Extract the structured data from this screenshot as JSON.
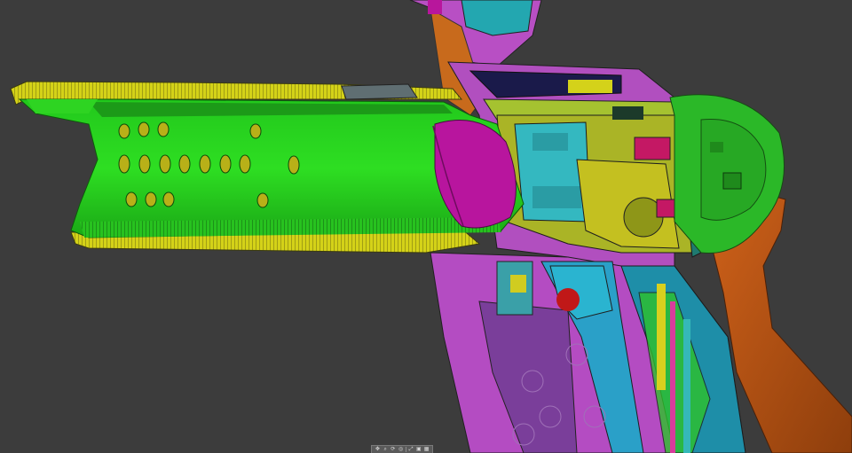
{
  "viewport": {
    "background": "#3c3c3c",
    "model_part_colors": {
      "barrel": "#22d41e",
      "barrel_shade": "#17a813",
      "shroud": "#d8d619",
      "bolt": "#b8159e",
      "frame": "#a84fb8",
      "receiver": "#2bb2b8",
      "hammer": "#e0e020",
      "grip": "#c65a14",
      "grip_panel": "#7a3e9a",
      "end_cap": "#2ac22a",
      "trigger_guard": "#2a9cc4",
      "trigger_part": "#c01818"
    }
  },
  "nav_bar": {
    "buttons": [
      {
        "icon": "pan-icon",
        "glyph": "✥"
      },
      {
        "icon": "zoom-icon",
        "glyph": "⌕"
      },
      {
        "icon": "orbit-icon",
        "glyph": "⟳"
      },
      {
        "icon": "look-at-icon",
        "glyph": "◎"
      },
      {
        "icon": "fit-view-icon",
        "glyph": "⤢"
      },
      {
        "icon": "display-settings-icon",
        "glyph": "▣"
      },
      {
        "icon": "grid-icon",
        "glyph": "▦"
      }
    ]
  }
}
